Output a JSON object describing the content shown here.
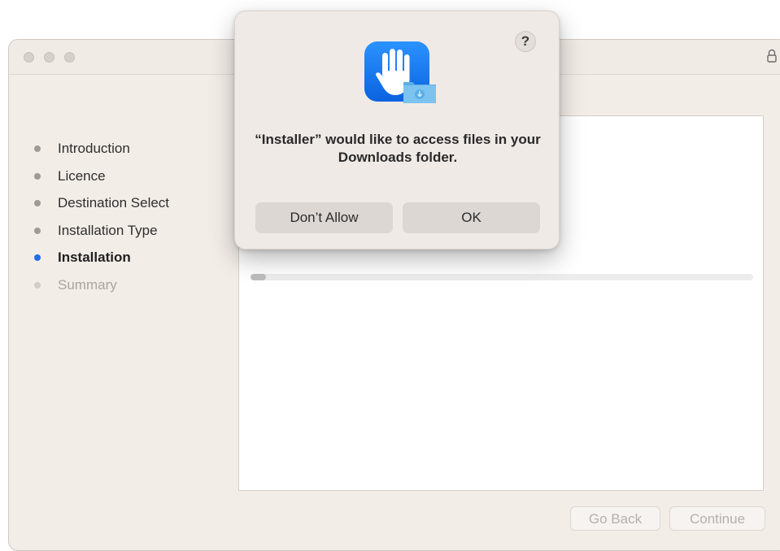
{
  "window": {
    "sidebar": {
      "steps": [
        {
          "label": "Introduction",
          "state": "done"
        },
        {
          "label": "Licence",
          "state": "done"
        },
        {
          "label": "Destination Select",
          "state": "done"
        },
        {
          "label": "Installation Type",
          "state": "done"
        },
        {
          "label": "Installation",
          "state": "current"
        },
        {
          "label": "Summary",
          "state": "pending"
        }
      ]
    },
    "progress": 0.03,
    "buttons": {
      "go_back": "Go Back",
      "continue": "Continue"
    },
    "icons": {
      "lock": "lock-icon"
    }
  },
  "dialog": {
    "help_label": "?",
    "message": "“Installer” would like to access files in your Downloads folder.",
    "buttons": {
      "dont_allow": "Don’t Allow",
      "ok": "OK"
    },
    "icon": "privacy-hand-icon"
  },
  "colors": {
    "accent": "#1f6fe8",
    "icon_blue": "#1a7cf5",
    "folder_blue": "#7cc3f0"
  }
}
